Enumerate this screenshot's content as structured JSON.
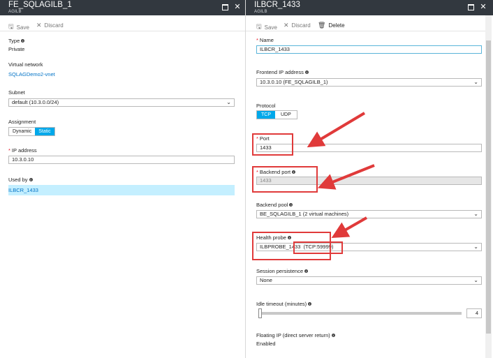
{
  "left_blade": {
    "title": "FE_SQLAGILB_1",
    "subtitle": "AGILB",
    "toolbar": {
      "save": "Save",
      "discard": "Discard"
    },
    "type_label": "Type",
    "type_value": "Private",
    "vnet_label": "Virtual network",
    "vnet_value": "SQLAGDemo2-vnet",
    "subnet_label": "Subnet",
    "subnet_value": "default (10.3.0.0/24)",
    "assignment_label": "Assignment",
    "assignment_options": [
      "Dynamic",
      "Static"
    ],
    "assignment_selected": "Static",
    "ip_label": "IP address",
    "ip_value": "10.3.0.10",
    "used_by_label": "Used by",
    "used_by_value": "ILBCR_1433"
  },
  "right_blade": {
    "title": "ILBCR_1433",
    "subtitle": "AGILB",
    "toolbar": {
      "save": "Save",
      "discard": "Discard",
      "delete": "Delete"
    },
    "name_label": "Name",
    "name_value": "ILBCR_1433",
    "frontend_label": "Frontend IP address",
    "frontend_value": "10.3.0.10 (FE_SQLAGILB_1)",
    "protocol_label": "Protocol",
    "protocol_options": [
      "TCP",
      "UDP"
    ],
    "protocol_selected": "TCP",
    "port_label": "Port",
    "port_value": "1433",
    "backend_port_label": "Backend port",
    "backend_port_value": "1433",
    "backend_pool_label": "Backend pool",
    "backend_pool_value": "BE_SQLAGILB_1 (2 virtual machines)",
    "health_probe_label": "Health probe",
    "health_probe_value": "ILBPROBE_1433",
    "health_probe_detail": "(TCP:59999)",
    "session_label": "Session persistence",
    "session_value": "None",
    "idle_label": "Idle timeout (minutes)",
    "idle_value": "4",
    "idle_fraction": 0.0,
    "floating_label": "Floating IP (direct server return)",
    "floating_value": "Enabled"
  },
  "colors": {
    "header_bg": "#32383f",
    "accent": "#00a8ea",
    "link": "#0072c6",
    "annotation": "#e03a3a",
    "selected_row": "#c4efff"
  },
  "icons": [
    "save-icon",
    "discard-icon",
    "delete-icon",
    "maximize-icon",
    "close-icon",
    "info-icon",
    "chevron-down-icon",
    "annotation-arrow-icon"
  ]
}
